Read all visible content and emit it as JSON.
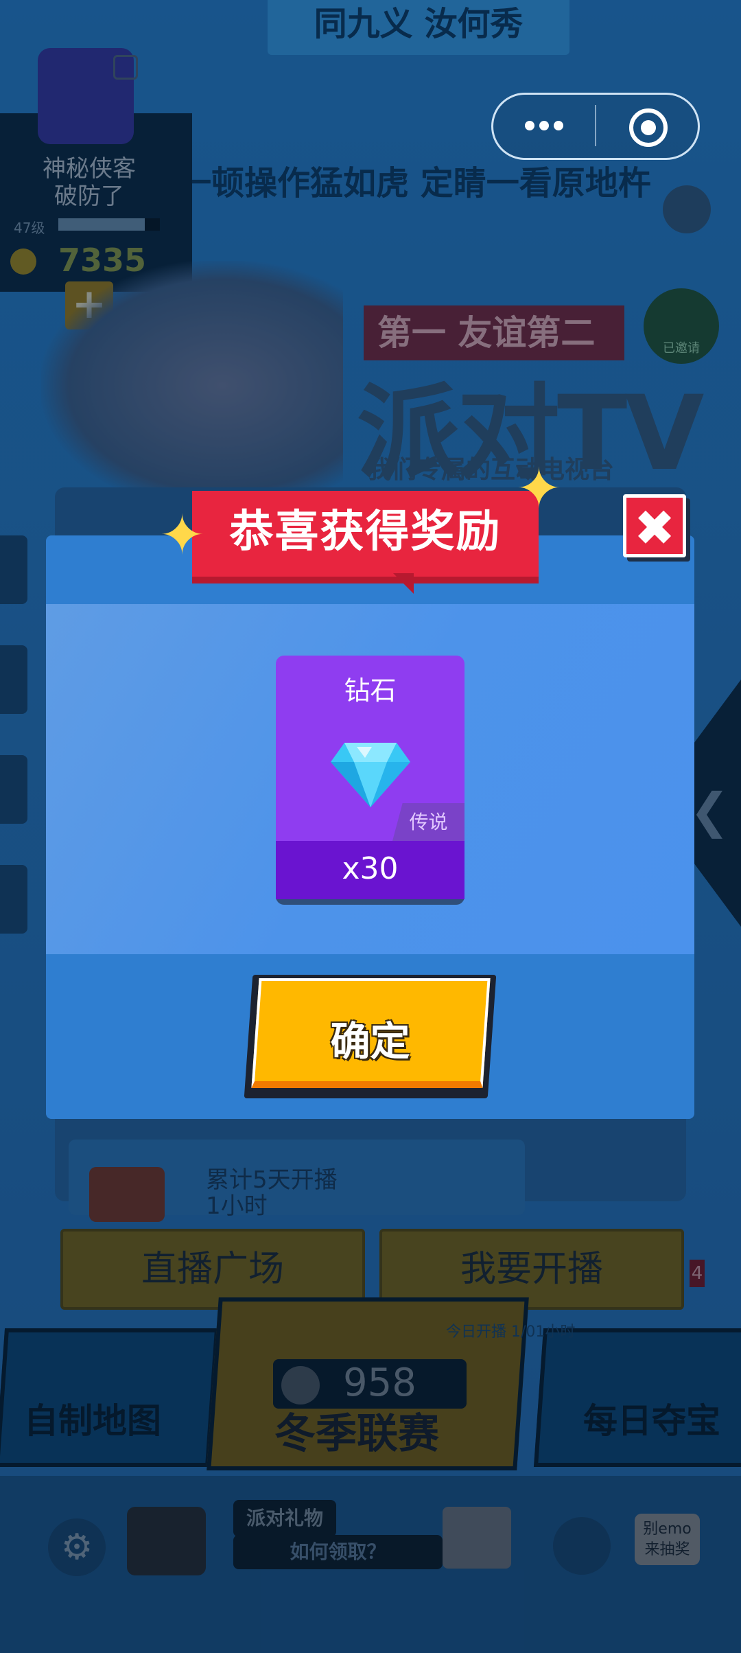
{
  "background": {
    "banner_title": "同九义 汝何秀",
    "marquee": "一顿操作猛如虎 定睛一看原地杵",
    "profile": {
      "name": "神秘侠客",
      "status": "破防了",
      "level": "47级",
      "level_progress": 0.85,
      "coins": "7335"
    },
    "event": {
      "ribbon": "第一 友谊第二",
      "title": "派对TV",
      "subtitle": "我们专属的互动电视台"
    },
    "joined_badge": "已邀请",
    "task_text": "累计5天开播\n1小时",
    "buttons": {
      "plaza": "直播广场",
      "broadcast": "我要开播"
    },
    "count_badge": "4",
    "tiles": {
      "map_maker": "自制地图",
      "season": "冬季联赛",
      "treasure": "每日夺宝",
      "treasure_note": "今日开播 1/01小时"
    },
    "gem_total": "958",
    "bottom": {
      "gift_title": "派对礼物",
      "gift_howto": "如何领取？",
      "lottery": "别emo\n来抽奖"
    }
  },
  "capsule": {
    "more_icon": "more-dots-icon",
    "close_icon": "miniprogram-close-icon"
  },
  "dialog": {
    "title": "恭喜获得奖励",
    "close_icon": "close-x-icon",
    "reward": {
      "name": "钻石",
      "icon": "diamond-icon",
      "rarity": "传说",
      "quantity": "x30"
    },
    "confirm_label": "确定"
  },
  "colors": {
    "ribbon_red": "#e8253f",
    "dialog_blue": "#2f7ed0",
    "card_purple": "#8f3df0",
    "confirm_yellow": "#ffb800"
  }
}
